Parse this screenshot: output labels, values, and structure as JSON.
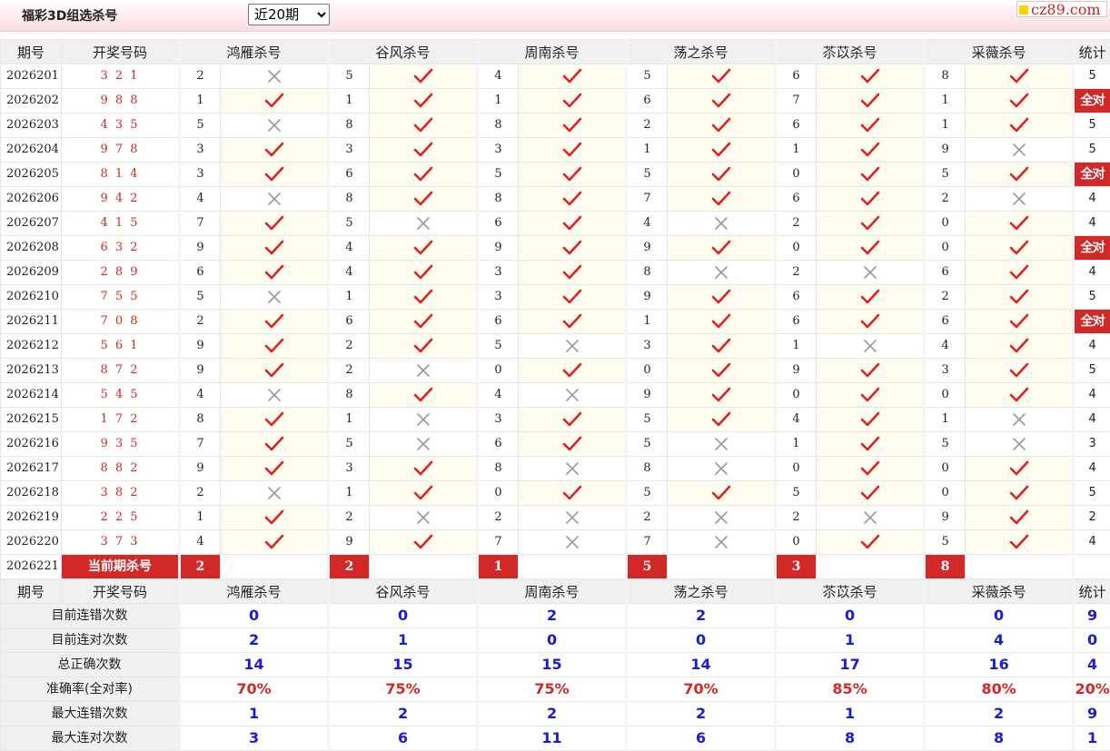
{
  "header": {
    "title": "福彩3D组选杀号",
    "select_value": "近20期",
    "logo_text": "cz89.com"
  },
  "columns": {
    "issue": "期号",
    "draw": "开奖号码",
    "experts": [
      "鸿雁杀号",
      "谷风杀号",
      "周南杀号",
      "荡之杀号",
      "苶苡杀号",
      "采薇杀号"
    ],
    "stat": "统计"
  },
  "rows": [
    {
      "issue": "2026201",
      "draw": "3 2 1",
      "picks": [
        [
          2,
          0
        ],
        [
          5,
          1
        ],
        [
          4,
          1
        ],
        [
          5,
          1
        ],
        [
          6,
          1
        ],
        [
          8,
          1
        ]
      ],
      "count": "5"
    },
    {
      "issue": "2026202",
      "draw": "9 8 8",
      "picks": [
        [
          1,
          1
        ],
        [
          1,
          1
        ],
        [
          1,
          1
        ],
        [
          6,
          1
        ],
        [
          7,
          1
        ],
        [
          1,
          1
        ]
      ],
      "count": "全对"
    },
    {
      "issue": "2026203",
      "draw": "4 3 5",
      "picks": [
        [
          5,
          0
        ],
        [
          8,
          1
        ],
        [
          8,
          1
        ],
        [
          2,
          1
        ],
        [
          6,
          1
        ],
        [
          1,
          1
        ]
      ],
      "count": "5"
    },
    {
      "issue": "2026204",
      "draw": "9 7 8",
      "picks": [
        [
          3,
          1
        ],
        [
          3,
          1
        ],
        [
          3,
          1
        ],
        [
          1,
          1
        ],
        [
          1,
          1
        ],
        [
          9,
          0
        ]
      ],
      "count": "5"
    },
    {
      "issue": "2026205",
      "draw": "8 1 4",
      "picks": [
        [
          3,
          1
        ],
        [
          6,
          1
        ],
        [
          5,
          1
        ],
        [
          5,
          1
        ],
        [
          0,
          1
        ],
        [
          5,
          1
        ]
      ],
      "count": "全对"
    },
    {
      "issue": "2026206",
      "draw": "9 4 2",
      "picks": [
        [
          4,
          0
        ],
        [
          8,
          1
        ],
        [
          8,
          1
        ],
        [
          7,
          1
        ],
        [
          6,
          1
        ],
        [
          2,
          0
        ]
      ],
      "count": "4"
    },
    {
      "issue": "2026207",
      "draw": "4 1 5",
      "picks": [
        [
          7,
          1
        ],
        [
          5,
          0
        ],
        [
          6,
          1
        ],
        [
          4,
          0
        ],
        [
          2,
          1
        ],
        [
          0,
          1
        ]
      ],
      "count": "4"
    },
    {
      "issue": "2026208",
      "draw": "6 3 2",
      "picks": [
        [
          9,
          1
        ],
        [
          4,
          1
        ],
        [
          9,
          1
        ],
        [
          9,
          1
        ],
        [
          0,
          1
        ],
        [
          0,
          1
        ]
      ],
      "count": "全对"
    },
    {
      "issue": "2026209",
      "draw": "2 8 9",
      "picks": [
        [
          6,
          1
        ],
        [
          4,
          1
        ],
        [
          3,
          1
        ],
        [
          8,
          0
        ],
        [
          2,
          0
        ],
        [
          6,
          1
        ]
      ],
      "count": "4"
    },
    {
      "issue": "2026210",
      "draw": "7 5 5",
      "picks": [
        [
          5,
          0
        ],
        [
          1,
          1
        ],
        [
          3,
          1
        ],
        [
          9,
          1
        ],
        [
          6,
          1
        ],
        [
          2,
          1
        ]
      ],
      "count": "5"
    },
    {
      "issue": "2026211",
      "draw": "7 0 8",
      "picks": [
        [
          2,
          1
        ],
        [
          6,
          1
        ],
        [
          6,
          1
        ],
        [
          1,
          1
        ],
        [
          6,
          1
        ],
        [
          6,
          1
        ]
      ],
      "count": "全对"
    },
    {
      "issue": "2026212",
      "draw": "5 6 1",
      "picks": [
        [
          9,
          1
        ],
        [
          2,
          1
        ],
        [
          5,
          0
        ],
        [
          3,
          1
        ],
        [
          1,
          0
        ],
        [
          4,
          1
        ]
      ],
      "count": "4"
    },
    {
      "issue": "2026213",
      "draw": "8 7 2",
      "picks": [
        [
          9,
          1
        ],
        [
          2,
          0
        ],
        [
          0,
          1
        ],
        [
          0,
          1
        ],
        [
          9,
          1
        ],
        [
          3,
          1
        ]
      ],
      "count": "5"
    },
    {
      "issue": "2026214",
      "draw": "5 4 5",
      "picks": [
        [
          4,
          0
        ],
        [
          8,
          1
        ],
        [
          4,
          0
        ],
        [
          9,
          1
        ],
        [
          0,
          1
        ],
        [
          0,
          1
        ]
      ],
      "count": "4"
    },
    {
      "issue": "2026215",
      "draw": "1 7 2",
      "picks": [
        [
          8,
          1
        ],
        [
          1,
          0
        ],
        [
          3,
          1
        ],
        [
          5,
          1
        ],
        [
          4,
          1
        ],
        [
          1,
          0
        ]
      ],
      "count": "4"
    },
    {
      "issue": "2026216",
      "draw": "9 3 5",
      "picks": [
        [
          7,
          1
        ],
        [
          5,
          0
        ],
        [
          6,
          1
        ],
        [
          5,
          0
        ],
        [
          1,
          1
        ],
        [
          5,
          0
        ]
      ],
      "count": "3"
    },
    {
      "issue": "2026217",
      "draw": "8 8 2",
      "picks": [
        [
          9,
          1
        ],
        [
          3,
          1
        ],
        [
          8,
          0
        ],
        [
          8,
          0
        ],
        [
          0,
          1
        ],
        [
          0,
          1
        ]
      ],
      "count": "4"
    },
    {
      "issue": "2026218",
      "draw": "3 8 2",
      "picks": [
        [
          2,
          0
        ],
        [
          1,
          1
        ],
        [
          0,
          1
        ],
        [
          5,
          1
        ],
        [
          5,
          1
        ],
        [
          0,
          1
        ]
      ],
      "count": "5"
    },
    {
      "issue": "2026219",
      "draw": "2 2 5",
      "picks": [
        [
          1,
          1
        ],
        [
          2,
          0
        ],
        [
          2,
          0
        ],
        [
          2,
          0
        ],
        [
          2,
          0
        ],
        [
          9,
          1
        ]
      ],
      "count": "2"
    },
    {
      "issue": "2026220",
      "draw": "3 7 3",
      "picks": [
        [
          4,
          1
        ],
        [
          9,
          1
        ],
        [
          7,
          0
        ],
        [
          7,
          0
        ],
        [
          0,
          1
        ],
        [
          5,
          1
        ]
      ],
      "count": "4"
    }
  ],
  "current": {
    "issue": "2026221",
    "label": "当前期杀号",
    "picks": [
      "2",
      "2",
      "1",
      "5",
      "3",
      "8"
    ]
  },
  "stats": [
    {
      "label": "目前连错次数",
      "values": [
        "0",
        "0",
        "2",
        "2",
        "0",
        "0"
      ],
      "total": "9",
      "color": "blue"
    },
    {
      "label": "目前连对次数",
      "values": [
        "2",
        "1",
        "0",
        "0",
        "1",
        "4"
      ],
      "total": "0",
      "color": "blue"
    },
    {
      "label": "总正确次数",
      "values": [
        "14",
        "15",
        "15",
        "14",
        "17",
        "16"
      ],
      "total": "4",
      "color": "blue"
    },
    {
      "label": "准确率(全对率)",
      "values": [
        "70%",
        "75%",
        "75%",
        "70%",
        "85%",
        "80%"
      ],
      "total": "20%",
      "color": "red"
    },
    {
      "label": "最大连错次数",
      "values": [
        "1",
        "2",
        "2",
        "2",
        "1",
        "2"
      ],
      "total": "9",
      "color": "blue"
    },
    {
      "label": "最大连对次数",
      "values": [
        "3",
        "6",
        "11",
        "6",
        "8",
        "8"
      ],
      "total": "1",
      "color": "blue"
    }
  ],
  "colors": {
    "accent": "#d12828",
    "stat_blue": "#1a1adb",
    "check": "#e02020",
    "cross": "#9a9a9a"
  },
  "icons": {
    "correct": "check-icon",
    "wrong": "cross-icon"
  }
}
